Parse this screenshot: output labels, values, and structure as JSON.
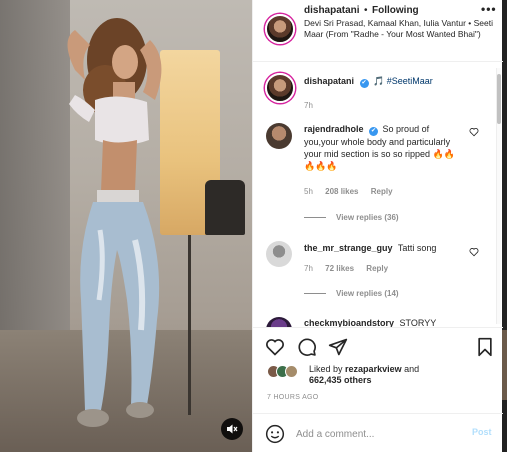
{
  "header": {
    "username": "dishapatani",
    "separator": "•",
    "follow_label": "Following",
    "audio": "Devi Sri Prasad, Kamaal Khan, Iulia Vantur • Seeti Maar (From \"Radhe - Your Most Wanted Bhai\")",
    "more_label": "•••"
  },
  "caption": {
    "username": "dishapatani",
    "verified_badge": "✔",
    "text": "🎵 #SeetiMaar",
    "time": "7h"
  },
  "comments": [
    {
      "username": "rajendradhole",
      "verified": true,
      "text": "So proud of you,your whole body and particularly your mid section is so so ripped 🔥🔥🔥🔥🔥",
      "time": "5h",
      "likes": "208 likes",
      "reply_label": "Reply",
      "view_replies": "View replies (36)"
    },
    {
      "username": "the_mr_strange_guy",
      "verified": false,
      "text": "Tatti song",
      "time": "7h",
      "likes": "72 likes",
      "reply_label": "Reply",
      "view_replies": "View replies (14)"
    },
    {
      "username": "checkmybioandstory",
      "verified": false,
      "text": "STORYY"
    }
  ],
  "likes": {
    "prefix": "Liked by",
    "user": "rezaparkview",
    "connector": "and",
    "count": "662,435 others"
  },
  "timestamp": "7 HOURS AGO",
  "add_comment": {
    "placeholder": "Add a comment...",
    "post_label": "Post"
  },
  "colors": {
    "link_blue": "#00376b",
    "verified_blue": "#3897f0",
    "post_disabled": "#b2dffc",
    "muted_text": "#8e8e8e"
  },
  "icons": [
    "heart-icon",
    "comment-icon",
    "share-icon",
    "save-icon",
    "emoji-icon",
    "mute-icon",
    "more-icon"
  ]
}
